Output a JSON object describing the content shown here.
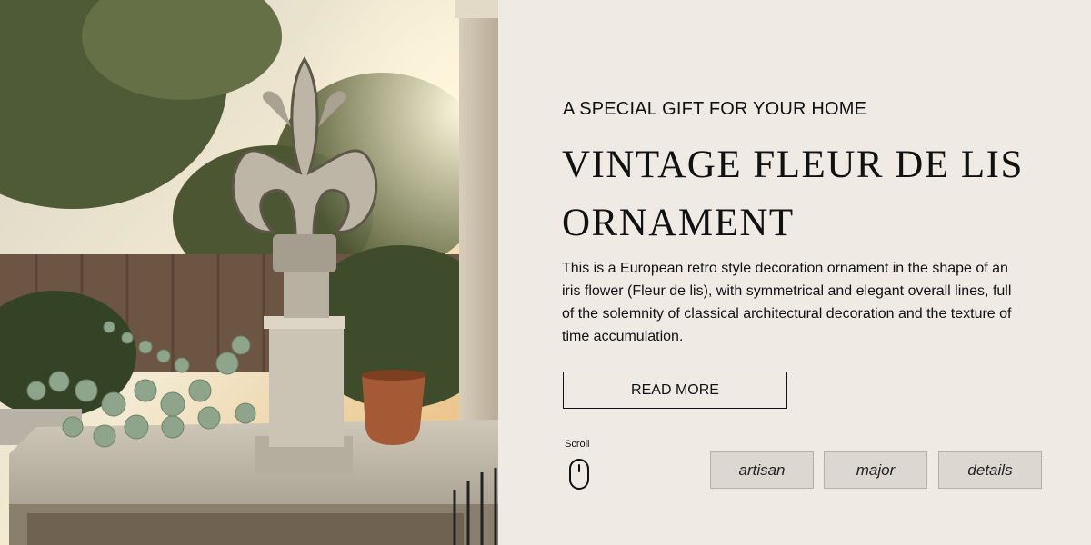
{
  "hero": {
    "eyebrow": "A SPECIAL GIFT FOR YOUR HOME",
    "title_line1": "VINTAGE FLEUR DE LIS",
    "title_line2": "ORNAMENT",
    "description": "This is a European retro style decoration ornament in the shape of an iris flower (Fleur de lis), with symmetrical and elegant overall lines, full of the solemnity of classical architectural decoration and the texture of time accumulation.",
    "read_more_label": "READ MORE",
    "scroll_label": "Scroll"
  },
  "tags": [
    "artisan",
    "major",
    "details"
  ],
  "colors": {
    "panel_background": "#efebe4",
    "tag_background": "#dcd8d1",
    "text": "#111111"
  },
  "icons": [
    "mouse-icon"
  ]
}
